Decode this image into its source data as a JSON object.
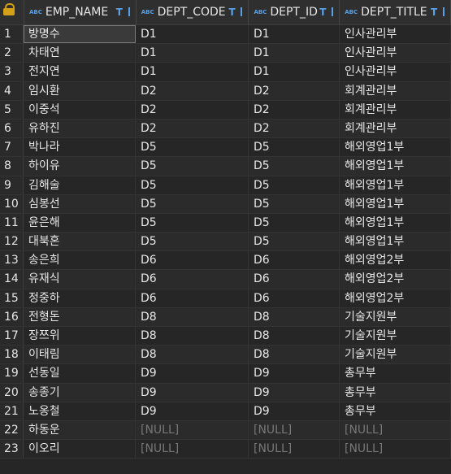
{
  "columns": [
    {
      "label": "EMP_NAME"
    },
    {
      "label": "DEPT_CODE"
    },
    {
      "label": "DEPT_ID"
    },
    {
      "label": "DEPT_TITLE"
    }
  ],
  "type_badge": "ABC",
  "rows": [
    {
      "n": "1",
      "emp": "방명수",
      "code": "D1",
      "id": "D1",
      "title": "인사관리부"
    },
    {
      "n": "2",
      "emp": "차태연",
      "code": "D1",
      "id": "D1",
      "title": "인사관리부"
    },
    {
      "n": "3",
      "emp": "전지연",
      "code": "D1",
      "id": "D1",
      "title": "인사관리부"
    },
    {
      "n": "4",
      "emp": "임시환",
      "code": "D2",
      "id": "D2",
      "title": "회계관리부"
    },
    {
      "n": "5",
      "emp": "이중석",
      "code": "D2",
      "id": "D2",
      "title": "회계관리부"
    },
    {
      "n": "6",
      "emp": "유하진",
      "code": "D2",
      "id": "D2",
      "title": "회계관리부"
    },
    {
      "n": "7",
      "emp": "박나라",
      "code": "D5",
      "id": "D5",
      "title": "해외영업1부"
    },
    {
      "n": "8",
      "emp": "하이유",
      "code": "D5",
      "id": "D5",
      "title": "해외영업1부"
    },
    {
      "n": "9",
      "emp": "김해술",
      "code": "D5",
      "id": "D5",
      "title": "해외영업1부"
    },
    {
      "n": "10",
      "emp": "심봉선",
      "code": "D5",
      "id": "D5",
      "title": "해외영업1부"
    },
    {
      "n": "11",
      "emp": "윤은해",
      "code": "D5",
      "id": "D5",
      "title": "해외영업1부"
    },
    {
      "n": "12",
      "emp": "대북혼",
      "code": "D5",
      "id": "D5",
      "title": "해외영업1부"
    },
    {
      "n": "13",
      "emp": "송은희",
      "code": "D6",
      "id": "D6",
      "title": "해외영업2부"
    },
    {
      "n": "14",
      "emp": "유재식",
      "code": "D6",
      "id": "D6",
      "title": "해외영업2부"
    },
    {
      "n": "15",
      "emp": "정중하",
      "code": "D6",
      "id": "D6",
      "title": "해외영업2부"
    },
    {
      "n": "16",
      "emp": "전형돈",
      "code": "D8",
      "id": "D8",
      "title": "기술지원부"
    },
    {
      "n": "17",
      "emp": "장쯔위",
      "code": "D8",
      "id": "D8",
      "title": "기술지원부"
    },
    {
      "n": "18",
      "emp": "이태림",
      "code": "D8",
      "id": "D8",
      "title": "기술지원부"
    },
    {
      "n": "19",
      "emp": "선동일",
      "code": "D9",
      "id": "D9",
      "title": "총무부"
    },
    {
      "n": "20",
      "emp": "송종기",
      "code": "D9",
      "id": "D9",
      "title": "총무부"
    },
    {
      "n": "21",
      "emp": "노옹철",
      "code": "D9",
      "id": "D9",
      "title": "총무부"
    },
    {
      "n": "22",
      "emp": "하동운",
      "code": "[NULL]",
      "id": "[NULL]",
      "title": "[NULL]"
    },
    {
      "n": "23",
      "emp": "이오리",
      "code": "[NULL]",
      "id": "[NULL]",
      "title": "[NULL]"
    }
  ]
}
